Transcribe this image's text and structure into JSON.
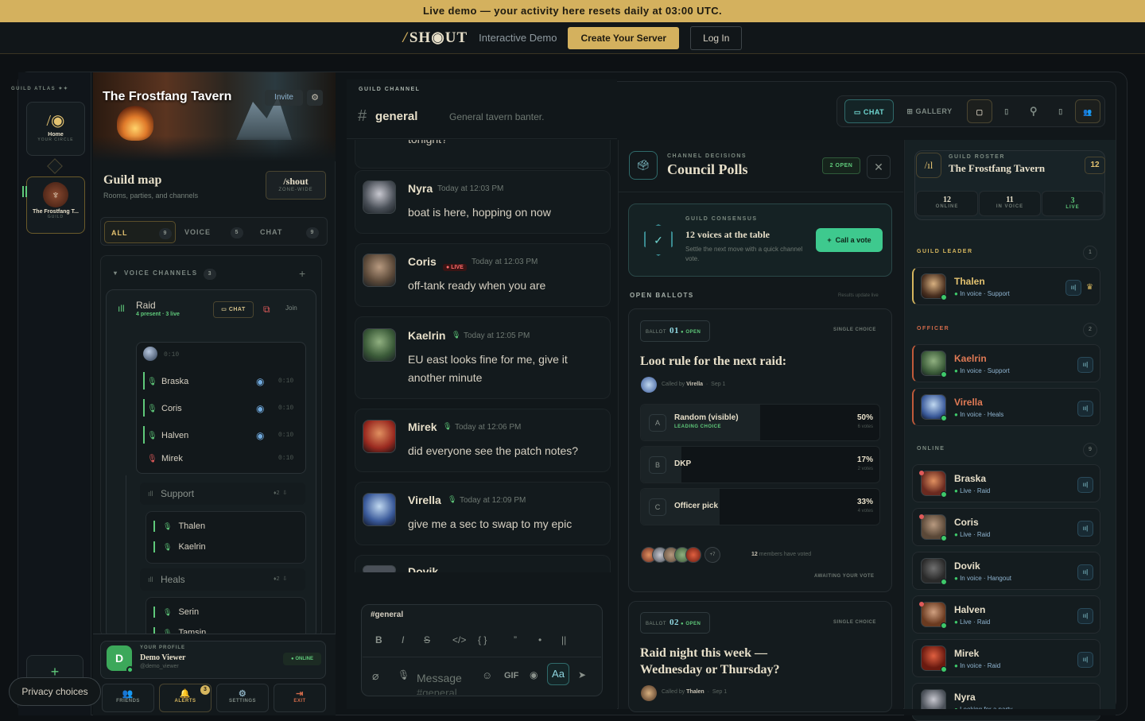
{
  "banner": "Live demo — your activity here resets daily at 03:00 UTC.",
  "topbar": {
    "logo_slash": "/",
    "logo_text": "SH◉UT",
    "demo": "Interactive Demo",
    "create": "Create Your Server",
    "login": "Log In"
  },
  "rail": {
    "title": "GUILD ATLAS ✦✦",
    "home": {
      "label": "Home",
      "sub": "YOUR CIRCLE"
    },
    "guild": {
      "label": "The Frostfang T...",
      "sub": "GUILD"
    },
    "add": "+"
  },
  "guild": {
    "name": "The Frostfang Tavern",
    "invite": "Invite",
    "map_title": "Guild map",
    "map_sub": "Rooms, parties, and channels",
    "shout_btn": "/shout",
    "shout_sub": "ZONE-WIDE",
    "tabs": [
      {
        "label": "ALL",
        "count": "9"
      },
      {
        "label": "VOICE",
        "count": "5"
      },
      {
        "label": "CHAT",
        "count": "9"
      }
    ],
    "voice_header": "VOICE CHANNELS",
    "voice_count": "3",
    "raid": {
      "name": "Raid",
      "sub": "4 present · 3 live",
      "chat": "CHAT",
      "join": "Join",
      "timer": "0:10",
      "members": [
        {
          "name": "Braska",
          "time": "0:10"
        },
        {
          "name": "Coris",
          "time": "0:10"
        },
        {
          "name": "Halven",
          "time": "0:10"
        },
        {
          "name": "Mirek",
          "time": "0:10"
        }
      ]
    },
    "support": {
      "name": "Support",
      "count": "2",
      "members": [
        "Thalen",
        "Kaelrin"
      ]
    },
    "heals": {
      "name": "Heals",
      "count": "2",
      "members": [
        "Serin",
        "Tamsin"
      ]
    }
  },
  "profile": {
    "label": "YOUR PROFILE",
    "initial": "D",
    "name": "Demo Viewer",
    "handle": "@demo_viewer",
    "status": "ONLINE"
  },
  "nav": [
    {
      "label": "FRIENDS",
      "icon": "friends-icon"
    },
    {
      "label": "ALERTS",
      "icon": "bell-icon",
      "badge": "3"
    },
    {
      "label": "SETTINGS",
      "icon": "gear-icon"
    },
    {
      "label": "EXIT",
      "icon": "exit-icon"
    }
  ],
  "privacy": "Privacy choices",
  "channel": {
    "label": "GUILD CHANNEL",
    "hash": "#",
    "name": "general",
    "desc": "General tavern banter."
  },
  "header_tools": {
    "chat": "CHAT",
    "gallery": "GALLERY"
  },
  "messages": [
    {
      "partial": "tonight?"
    },
    {
      "user": "Nyra",
      "time": "Today at 12:03 PM",
      "text": "boat is here, hopping on now",
      "live": false
    },
    {
      "user": "Coris",
      "time": "Today at 12:03 PM",
      "text": "off-tank ready when you are",
      "live": true,
      "live_label": "LIVE"
    },
    {
      "user": "Kaelrin",
      "time": "Today at 12:05 PM",
      "text": "EU east looks fine for me, give it another minute",
      "live": false
    },
    {
      "user": "Mirek",
      "time": "Today at 12:06 PM",
      "text": "did everyone see the patch notes?",
      "live": false
    },
    {
      "user": "Virella",
      "time": "Today at 12:09 PM",
      "text": "give me a sec to swap to my epic",
      "live": false
    },
    {
      "user": "Dovik",
      "time": "Today at 12:09 PM",
      "text": "",
      "live": false
    }
  ],
  "composer": {
    "channel": "#general",
    "placeholder": "Message",
    "placeholder2": "#general",
    "gif": "GIF",
    "aa": "Aa",
    "formats": [
      "B",
      "I",
      "S",
      "</>",
      "{ }",
      "”",
      "•",
      "||"
    ]
  },
  "polls": {
    "label": "CHANNEL DECISIONS",
    "title": "Council Polls",
    "open": "2 OPEN",
    "consensus": {
      "label": "GUILD CONSENSUS",
      "title": "12 voices at the table",
      "sub": "Settle the next move with a quick channel vote.",
      "button": "Call a vote"
    },
    "open_label": "OPEN BALLOTS",
    "open_note": "Results update live",
    "ballots": [
      {
        "tag": "BALLOT",
        "num": "01",
        "status": "OPEN",
        "kind": "SINGLE CHOICE",
        "question": "Loot rule for the next raid:",
        "called_by": "Virella",
        "date": "Sep 1",
        "options": [
          {
            "letter": "A",
            "name": "Random (visible)",
            "lead": "LEADING CHOICE",
            "pct": "50%",
            "votes": "6 votes",
            "value": 50
          },
          {
            "letter": "B",
            "name": "DKP",
            "pct": "17%",
            "votes": "2 votes",
            "value": 17
          },
          {
            "letter": "C",
            "name": "Officer pick",
            "pct": "33%",
            "votes": "4 votes",
            "value": 33
          }
        ],
        "extra": "+7",
        "voted": "12",
        "voted_text": "members have voted",
        "await": "AWAITING YOUR VOTE"
      },
      {
        "tag": "BALLOT",
        "num": "02",
        "status": "OPEN",
        "kind": "SINGLE CHOICE",
        "question": "Raid night this week — Wednesday or Thursday?",
        "called_by": "Thalen",
        "date": "Sep 1"
      }
    ],
    "called_prefix": "Called by"
  },
  "roster": {
    "label": "GUILD ROSTER",
    "name": "The Frostfang Tavern",
    "count": "12",
    "stats": [
      {
        "v": "12",
        "k": "ONLINE"
      },
      {
        "v": "11",
        "k": "IN VOICE"
      },
      {
        "v": "3",
        "k": "LIVE"
      }
    ],
    "sections": {
      "leader": {
        "label": "GUILD LEADER",
        "count": "1"
      },
      "officer": {
        "label": "OFFICER",
        "count": "2"
      },
      "online": {
        "label": "ONLINE",
        "count": "9"
      }
    },
    "leader": [
      {
        "name": "Thalen",
        "status": "In voice · Support"
      }
    ],
    "officers": [
      {
        "name": "Kaelrin",
        "status": "In voice · Support"
      },
      {
        "name": "Virella",
        "status": "In voice · Heals"
      }
    ],
    "online": [
      {
        "name": "Braska",
        "status": "Live · Raid"
      },
      {
        "name": "Coris",
        "status": "Live · Raid"
      },
      {
        "name": "Dovik",
        "status": "In voice · Hangout"
      },
      {
        "name": "Halven",
        "status": "Live · Raid"
      },
      {
        "name": "Mirek",
        "status": "In voice · Raid"
      },
      {
        "name": "Nyra",
        "status": "Looking for a party"
      }
    ]
  }
}
